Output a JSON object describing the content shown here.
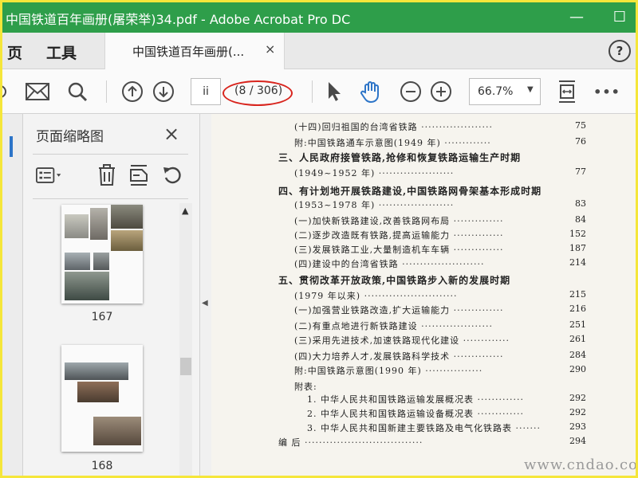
{
  "window": {
    "title": "中国铁道百年画册(屠荣举)34.pdf - Adobe Acrobat Pro DC",
    "minimize": "—",
    "maximize": "☐"
  },
  "tabs": {
    "home_partial": "页",
    "tools": "工具",
    "document_tab": "中国铁道百年画册(...",
    "close": "×",
    "help": "?"
  },
  "toolbar": {
    "page_input": "ii",
    "page_count": "(8 / 306)",
    "zoom": "66.7%",
    "more": "•••"
  },
  "panel": {
    "title": "页面缩略图",
    "close": "×",
    "thumbnails": [
      {
        "label": "167"
      },
      {
        "label": "168"
      }
    ]
  },
  "document": {
    "lines": [
      {
        "text": "(十四)回归祖国的台湾省铁路",
        "page": "75",
        "heading": false,
        "indent": 1
      },
      {
        "text": "附:中国铁路通车示意图(1949 年)",
        "page": "76",
        "heading": false,
        "indent": 1
      },
      {
        "text": "三、人民政府接管铁路,抢修和恢复铁路运输生产时期",
        "page": "",
        "heading": true,
        "indent": 0
      },
      {
        "text": "(1949~1952 年)",
        "page": "77",
        "heading": false,
        "indent": 1
      },
      {
        "text": "四、有计划地开展铁路建设,中国铁路网骨架基本形成时期",
        "page": "",
        "heading": true,
        "indent": 0
      },
      {
        "text": "(1953~1978 年)",
        "page": "83",
        "heading": false,
        "indent": 1
      },
      {
        "text": "(一)加快新铁路建设,改善铁路网布局",
        "page": "84",
        "heading": false,
        "indent": 1
      },
      {
        "text": "(二)逐步改造既有铁路,提高运输能力",
        "page": "152",
        "heading": false,
        "indent": 1
      },
      {
        "text": "(三)发展铁路工业,大量制造机车车辆",
        "page": "187",
        "heading": false,
        "indent": 1
      },
      {
        "text": "(四)建设中的台湾省铁路",
        "page": "214",
        "heading": false,
        "indent": 1
      },
      {
        "text": "五、贯彻改革开放政策,中国铁路步入新的发展时期",
        "page": "",
        "heading": true,
        "indent": 0
      },
      {
        "text": "(1979 年以来)",
        "page": "215",
        "heading": false,
        "indent": 1
      },
      {
        "text": "(一)加强营业铁路改造,扩大运输能力",
        "page": "216",
        "heading": false,
        "indent": 1
      },
      {
        "text": "(二)有重点地进行新铁路建设",
        "page": "251",
        "heading": false,
        "indent": 1
      },
      {
        "text": "(三)采用先进技术,加速铁路现代化建设",
        "page": "261",
        "heading": false,
        "indent": 1
      },
      {
        "text": "(四)大力培养人才,发展铁路科学技术",
        "page": "284",
        "heading": false,
        "indent": 1
      },
      {
        "text": "附:中国铁路示意图(1990 年)",
        "page": "290",
        "heading": false,
        "indent": 1
      },
      {
        "text": "附表:",
        "page": "",
        "heading": false,
        "indent": 1
      },
      {
        "text": "1. 中华人民共和国铁路运输发展概况表",
        "page": "292",
        "heading": false,
        "indent": 2
      },
      {
        "text": "2. 中华人民共和国铁路运输设备概况表",
        "page": "292",
        "heading": false,
        "indent": 2
      },
      {
        "text": "3. 中华人民共和国新建主要铁路及电气化铁路表",
        "page": "293",
        "heading": false,
        "indent": 2
      },
      {
        "text": "编   后",
        "page": "294",
        "heading": false,
        "indent": 0
      }
    ],
    "watermark": "www.cndao.com"
  },
  "colors": {
    "titlebar": "#2e9e4a",
    "accent_blue": "#2d75c8",
    "annotation_red": "#d8241d"
  }
}
